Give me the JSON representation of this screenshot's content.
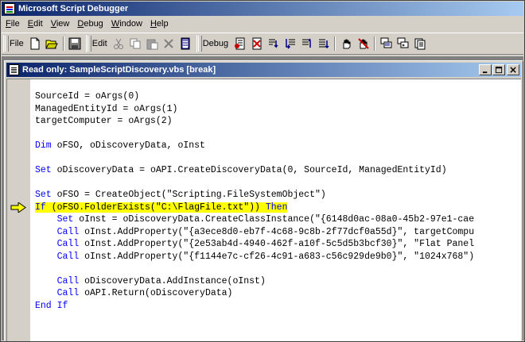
{
  "app": {
    "title": "Microsoft Script Debugger",
    "menu": [
      {
        "pre": "",
        "u": "F",
        "post": "ile"
      },
      {
        "pre": "",
        "u": "E",
        "post": "dit"
      },
      {
        "pre": "",
        "u": "V",
        "post": "iew"
      },
      {
        "pre": "",
        "u": "D",
        "post": "ebug"
      },
      {
        "pre": "",
        "u": "W",
        "post": "indow"
      },
      {
        "pre": "",
        "u": "H",
        "post": "elp"
      }
    ]
  },
  "toolbar": {
    "file_label": "File",
    "edit_label": "Edit",
    "debug_label": "Debug",
    "icons": {
      "new": "new-file-icon",
      "open": "open-folder-icon",
      "save": "save-icon",
      "cut": "cut-icon",
      "copy": "copy-icon",
      "paste": "paste-icon",
      "delete": "delete-icon",
      "find": "find-icon",
      "breakpoint": "toggle-breakpoint-icon",
      "clear": "clear-breakpoints-icon",
      "step_into": "step-into-icon",
      "step_over": "step-over-icon",
      "step_out": "step-out-icon",
      "run": "run-icon",
      "break": "break-icon",
      "stop": "stop-icon",
      "call_stack": "call-stack-icon",
      "command": "command-window-icon",
      "running_docs": "running-documents-icon"
    }
  },
  "document": {
    "title": "Read only: SampleScriptDiscovery.vbs [break]",
    "highlight_color": "#ffff00",
    "keyword_color": "#0000ff",
    "lines": [
      [
        {
          "t": "SourceId = oArgs(0)"
        }
      ],
      [
        {
          "t": "ManagedEntityId = oArgs(1)"
        }
      ],
      [
        {
          "t": "targetComputer = oArgs(2)"
        }
      ],
      [
        {
          "t": ""
        }
      ],
      [
        {
          "t": "Dim",
          "kw": true
        },
        {
          "t": " oFSO, oDiscoveryData, oInst"
        }
      ],
      [
        {
          "t": ""
        }
      ],
      [
        {
          "t": "Set",
          "kw": true
        },
        {
          "t": " oDiscoveryData = oAPI.CreateDiscoveryData(0, SourceId, ManagedEntityId)"
        }
      ],
      [
        {
          "t": ""
        }
      ],
      [
        {
          "t": "Set",
          "kw": true
        },
        {
          "t": " oFSO = CreateObject(\"Scripting.FileSystemObject\")"
        }
      ],
      [
        {
          "t": "If",
          "kw": true
        },
        {
          "t": " (oFSO.FolderExists(\"C:\\FlagFile.txt\")) "
        },
        {
          "t": "Then",
          "kw": true
        }
      ],
      [
        {
          "t": "    "
        },
        {
          "t": "Set",
          "kw": true
        },
        {
          "t": " oInst = oDiscoveryData.CreateClassInstance(\"{6148d0ac-08a0-45b2-97e1-cae"
        }
      ],
      [
        {
          "t": "    "
        },
        {
          "t": "Call",
          "kw": true
        },
        {
          "t": " oInst.AddProperty(\"{a3ece8d0-eb7f-4c68-9c8b-2f77dcf0a55d}\", targetCompu"
        }
      ],
      [
        {
          "t": "    "
        },
        {
          "t": "Call",
          "kw": true
        },
        {
          "t": " oInst.AddProperty(\"{2e53ab4d-4940-462f-a10f-5c5d5b3bcf30}\", \"Flat Panel"
        }
      ],
      [
        {
          "t": "    "
        },
        {
          "t": "Call",
          "kw": true
        },
        {
          "t": " oInst.AddProperty(\"{f1144e7c-cf26-4c91-a683-c56c929de9b0}\", \"1024x768\")"
        }
      ],
      [
        {
          "t": ""
        }
      ],
      [
        {
          "t": "    "
        },
        {
          "t": "Call",
          "kw": true
        },
        {
          "t": " oDiscoveryData.AddInstance(oInst)"
        }
      ],
      [
        {
          "t": "    "
        },
        {
          "t": "Call",
          "kw": true
        },
        {
          "t": " oAPI.Return(oDiscoveryData)"
        }
      ],
      [
        {
          "t": "End If",
          "kw": true
        }
      ]
    ],
    "current_line": 9
  }
}
